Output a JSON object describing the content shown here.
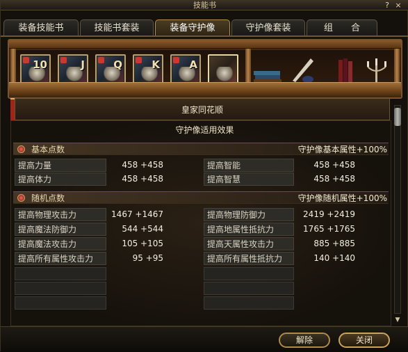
{
  "window": {
    "title": "技能书",
    "help": "?",
    "close": "×"
  },
  "tabs": [
    {
      "label": "装备技能书",
      "active": false
    },
    {
      "label": "技能书套装",
      "active": false
    },
    {
      "label": "装备守护像",
      "active": true
    },
    {
      "label": "守护像套装",
      "active": false
    },
    {
      "label": "组　　合",
      "active": false
    }
  ],
  "shelf": {
    "cards": [
      {
        "rank": "10",
        "locked": true
      },
      {
        "rank": "J",
        "locked": true
      },
      {
        "rank": "Q",
        "locked": true
      },
      {
        "rank": "K",
        "locked": true
      },
      {
        "rank": "A",
        "locked": true
      },
      {
        "rank": "",
        "locked": false
      }
    ]
  },
  "combo_name": "皇家同花顺",
  "effect_title": "守护像适用效果",
  "basic": {
    "label": "基本点数",
    "bonus": "守护像基本属性+100%",
    "rows": [
      {
        "l1": "提高力量",
        "v1": "458 +458",
        "l2": "提高智能",
        "v2": "458 +458"
      },
      {
        "l1": "提高体力",
        "v1": "458 +458",
        "l2": "提高智慧",
        "v2": "458 +458"
      }
    ]
  },
  "random": {
    "label": "随机点数",
    "bonus": "守护像随机属性+100%",
    "rows": [
      {
        "l1": "提高物理攻击力",
        "v1": "1467 +1467",
        "l2": "提高物理防御力",
        "v2": "2419 +2419"
      },
      {
        "l1": "提高魔法防御力",
        "v1": "544 +544",
        "l2": "提高地属性抵抗力",
        "v2": "1765 +1765"
      },
      {
        "l1": "提高魔法攻击力",
        "v1": "105 +105",
        "l2": "提高天属性攻击力",
        "v2": "885 +885"
      },
      {
        "l1": "提高所有属性攻击力",
        "v1": "95 +95",
        "l2": "提高所有属性抵抗力",
        "v2": "140 +140"
      }
    ]
  },
  "buttons": {
    "remove": "解除",
    "close": "关闭"
  },
  "colors": {
    "accent": "#b08a4a",
    "banner": "#a02418",
    "bonus_text": "#f3ead2"
  }
}
